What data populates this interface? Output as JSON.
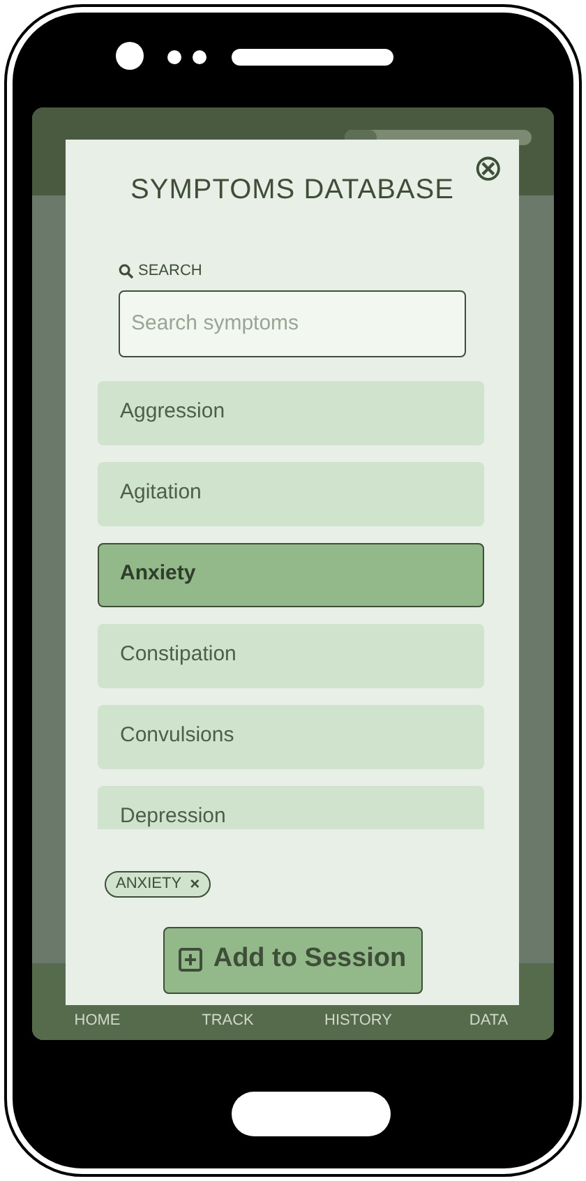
{
  "header": {
    "progress": {
      "level": 0.17
    }
  },
  "modal": {
    "title": "SYMPTOMS DATABASE",
    "close": "⊗",
    "search": {
      "label": "SEARCH",
      "placeholder": "Search symptoms"
    },
    "symptoms": [
      {
        "label": "Aggression",
        "selected": false
      },
      {
        "label": "Agitation",
        "selected": false
      },
      {
        "label": "Anxiety",
        "selected": true
      },
      {
        "label": "Constipation",
        "selected": false
      },
      {
        "label": "Convulsions",
        "selected": false
      },
      {
        "label": "Depression",
        "selected": false
      }
    ],
    "chips": [
      {
        "label": "ANXIETY",
        "remove": "×"
      }
    ],
    "button": "Add to Session"
  },
  "nav": [
    "HOME",
    "TRACK",
    "HISTORY",
    "DATA"
  ]
}
